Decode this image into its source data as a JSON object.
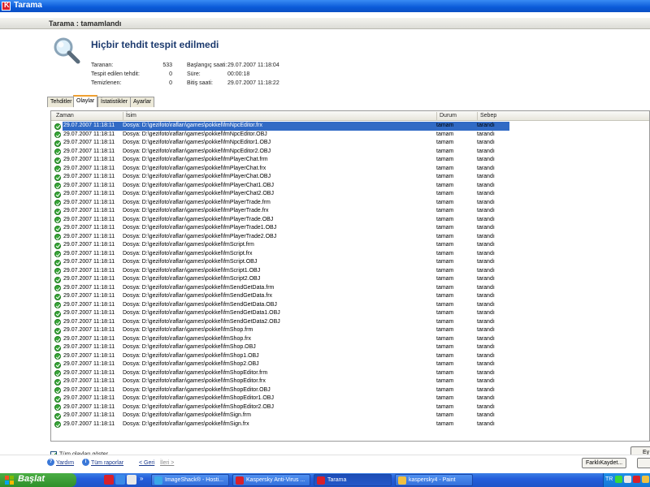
{
  "window": {
    "title": "Tarama"
  },
  "status": {
    "header": "Tarama : tamamlandı",
    "title": "Hiçbir tehdit tespit edilmedi",
    "stats": {
      "scanned_label": "Taranan:",
      "scanned_value": "533",
      "detected_label": "Tespit edilen tehdit:",
      "detected_value": "0",
      "cleaned_label": "Temizlenen:",
      "cleaned_value": "0",
      "start_label": "Başlangıç saati:",
      "start_value": "29.07.2007 11:18:04",
      "duration_label": "Süre:",
      "duration_value": "00:00:18",
      "end_label": "Bitiş saati:",
      "end_value": "29.07.2007 11:18:22"
    }
  },
  "tabs": [
    {
      "label": "Tehditler"
    },
    {
      "label": "Olaylar",
      "active": true
    },
    {
      "label": "İstatistikler"
    },
    {
      "label": "Ayarlar"
    }
  ],
  "table": {
    "columns": {
      "time": "Zaman",
      "name": "İsim",
      "state": "Durum",
      "reason": "Sebep"
    },
    "rows": [
      {
        "time": "29.07.2007 11:18:11",
        "name": "Dosya: D:\\gezifoto\\rafları\\games\\pokkel\\fmNpcEditor.frx",
        "state": "tamam",
        "reason": "tarandı"
      },
      {
        "time": "29.07.2007 11:18:11",
        "name": "Dosya: D:\\gezifoto\\rafları\\games\\pokkel\\fmNpcEditor.OBJ",
        "state": "tamam",
        "reason": "tarandı"
      },
      {
        "time": "29.07.2007 11:18:11",
        "name": "Dosya: D:\\gezifoto\\rafları\\games\\pokkel\\fmNpcEditor1.OBJ",
        "state": "tamam",
        "reason": "tarandı"
      },
      {
        "time": "29.07.2007 11:18:11",
        "name": "Dosya: D:\\gezifoto\\rafları\\games\\pokkel\\fmNpcEditor2.OBJ",
        "state": "tamam",
        "reason": "tarandı"
      },
      {
        "time": "29.07.2007 11:18:11",
        "name": "Dosya: D:\\gezifoto\\rafları\\games\\pokkel\\fmPlayerChat.frm",
        "state": "tamam",
        "reason": "tarandı"
      },
      {
        "time": "29.07.2007 11:18:11",
        "name": "Dosya: D:\\gezifoto\\rafları\\games\\pokkel\\fmPlayerChat.frx",
        "state": "tamam",
        "reason": "tarandı"
      },
      {
        "time": "29.07.2007 11:18:11",
        "name": "Dosya: D:\\gezifoto\\rafları\\games\\pokkel\\fmPlayerChat.OBJ",
        "state": "tamam",
        "reason": "tarandı"
      },
      {
        "time": "29.07.2007 11:18:11",
        "name": "Dosya: D:\\gezifoto\\rafları\\games\\pokkel\\fmPlayerChat1.OBJ",
        "state": "tamam",
        "reason": "tarandı"
      },
      {
        "time": "29.07.2007 11:18:11",
        "name": "Dosya: D:\\gezifoto\\rafları\\games\\pokkel\\fmPlayerChat2.OBJ",
        "state": "tamam",
        "reason": "tarandı"
      },
      {
        "time": "29.07.2007 11:18:11",
        "name": "Dosya: D:\\gezifoto\\rafları\\games\\pokkel\\fmPlayerTrade.frm",
        "state": "tamam",
        "reason": "tarandı"
      },
      {
        "time": "29.07.2007 11:18:11",
        "name": "Dosya: D:\\gezifoto\\rafları\\games\\pokkel\\fmPlayerTrade.frx",
        "state": "tamam",
        "reason": "tarandı"
      },
      {
        "time": "29.07.2007 11:18:11",
        "name": "Dosya: D:\\gezifoto\\rafları\\games\\pokkel\\fmPlayerTrade.OBJ",
        "state": "tamam",
        "reason": "tarandı"
      },
      {
        "time": "29.07.2007 11:18:11",
        "name": "Dosya: D:\\gezifoto\\rafları\\games\\pokkel\\fmPlayerTrade1.OBJ",
        "state": "tamam",
        "reason": "tarandı"
      },
      {
        "time": "29.07.2007 11:18:11",
        "name": "Dosya: D:\\gezifoto\\rafları\\games\\pokkel\\fmPlayerTrade2.OBJ",
        "state": "tamam",
        "reason": "tarandı"
      },
      {
        "time": "29.07.2007 11:18:11",
        "name": "Dosya: D:\\gezifoto\\rafları\\games\\pokkel\\fmScript.frm",
        "state": "tamam",
        "reason": "tarandı"
      },
      {
        "time": "29.07.2007 11:18:11",
        "name": "Dosya: D:\\gezifoto\\rafları\\games\\pokkel\\fmScript.frx",
        "state": "tamam",
        "reason": "tarandı"
      },
      {
        "time": "29.07.2007 11:18:11",
        "name": "Dosya: D:\\gezifoto\\rafları\\games\\pokkel\\fmScript.OBJ",
        "state": "tamam",
        "reason": "tarandı"
      },
      {
        "time": "29.07.2007 11:18:11",
        "name": "Dosya: D:\\gezifoto\\rafları\\games\\pokkel\\fmScript1.OBJ",
        "state": "tamam",
        "reason": "tarandı"
      },
      {
        "time": "29.07.2007 11:18:11",
        "name": "Dosya: D:\\gezifoto\\rafları\\games\\pokkel\\fmScript2.OBJ",
        "state": "tamam",
        "reason": "tarandı"
      },
      {
        "time": "29.07.2007 11:18:11",
        "name": "Dosya: D:\\gezifoto\\rafları\\games\\pokkel\\fmSendGetData.frm",
        "state": "tamam",
        "reason": "tarandı"
      },
      {
        "time": "29.07.2007 11:18:11",
        "name": "Dosya: D:\\gezifoto\\rafları\\games\\pokkel\\fmSendGetData.frx",
        "state": "tamam",
        "reason": "tarandı"
      },
      {
        "time": "29.07.2007 11:18:11",
        "name": "Dosya: D:\\gezifoto\\rafları\\games\\pokkel\\fmSendGetData.OBJ",
        "state": "tamam",
        "reason": "tarandı"
      },
      {
        "time": "29.07.2007 11:18:11",
        "name": "Dosya: D:\\gezifoto\\rafları\\games\\pokkel\\fmSendGetData1.OBJ",
        "state": "tamam",
        "reason": "tarandı"
      },
      {
        "time": "29.07.2007 11:18:11",
        "name": "Dosya: D:\\gezifoto\\rafları\\games\\pokkel\\fmSendGetData2.OBJ",
        "state": "tamam",
        "reason": "tarandı"
      },
      {
        "time": "29.07.2007 11:18:11",
        "name": "Dosya: D:\\gezifoto\\rafları\\games\\pokkel\\fmShop.frm",
        "state": "tamam",
        "reason": "tarandı"
      },
      {
        "time": "29.07.2007 11:18:11",
        "name": "Dosya: D:\\gezifoto\\rafları\\games\\pokkel\\fmShop.frx",
        "state": "tamam",
        "reason": "tarandı"
      },
      {
        "time": "29.07.2007 11:18:11",
        "name": "Dosya: D:\\gezifoto\\rafları\\games\\pokkel\\fmShop.OBJ",
        "state": "tamam",
        "reason": "tarandı"
      },
      {
        "time": "29.07.2007 11:18:11",
        "name": "Dosya: D:\\gezifoto\\rafları\\games\\pokkel\\fmShop1.OBJ",
        "state": "tamam",
        "reason": "tarandı"
      },
      {
        "time": "29.07.2007 11:18:11",
        "name": "Dosya: D:\\gezifoto\\rafları\\games\\pokkel\\fmShop2.OBJ",
        "state": "tamam",
        "reason": "tarandı"
      },
      {
        "time": "29.07.2007 11:18:11",
        "name": "Dosya: D:\\gezifoto\\rafları\\games\\pokkel\\fmShopEditor.frm",
        "state": "tamam",
        "reason": "tarandı"
      },
      {
        "time": "29.07.2007 11:18:11",
        "name": "Dosya: D:\\gezifoto\\rafları\\games\\pokkel\\fmShopEditor.frx",
        "state": "tamam",
        "reason": "tarandı"
      },
      {
        "time": "29.07.2007 11:18:11",
        "name": "Dosya: D:\\gezifoto\\rafları\\games\\pokkel\\fmShopEditor.OBJ",
        "state": "tamam",
        "reason": "tarandı"
      },
      {
        "time": "29.07.2007 11:18:11",
        "name": "Dosya: D:\\gezifoto\\rafları\\games\\pokkel\\fmShopEditor1.OBJ",
        "state": "tamam",
        "reason": "tarandı"
      },
      {
        "time": "29.07.2007 11:18:11",
        "name": "Dosya: D:\\gezifoto\\rafları\\games\\pokkel\\fmShopEditor2.OBJ",
        "state": "tamam",
        "reason": "tarandı"
      },
      {
        "time": "29.07.2007 11:18:11",
        "name": "Dosya: D:\\gezifoto\\rafları\\games\\pokkel\\fmSign.frm",
        "state": "tamam",
        "reason": "tarandı"
      },
      {
        "time": "29.07.2007 11:18:11",
        "name": "Dosya: D:\\gezifoto\\rafları\\games\\pokkel\\fmSign.frx",
        "state": "tamam",
        "reason": "tarandı"
      }
    ]
  },
  "show_all": {
    "label": "Tüm olayları göster",
    "checked": true
  },
  "right_button": {
    "label": "Ey"
  },
  "footer": {
    "help": "Yardım",
    "reports": "Tüm raporlar",
    "back": "< Geri",
    "next": "İleri >",
    "save_as": "FarklıKaydet..."
  },
  "taskbar": {
    "start": "Başlat",
    "tasks": [
      {
        "label": "ImageShack® - Hosti..."
      },
      {
        "label": "Kaspersky Anti-Virus ..."
      },
      {
        "label": "Tarama",
        "active": true
      },
      {
        "label": "kaspersky4 - Paint"
      }
    ],
    "tray_lang": "TR"
  },
  "colors": {
    "title_bar": "#0a5ad8",
    "selection": "#316ac5",
    "ok_green": "#3aa83a",
    "link": "#1c3a8c"
  }
}
